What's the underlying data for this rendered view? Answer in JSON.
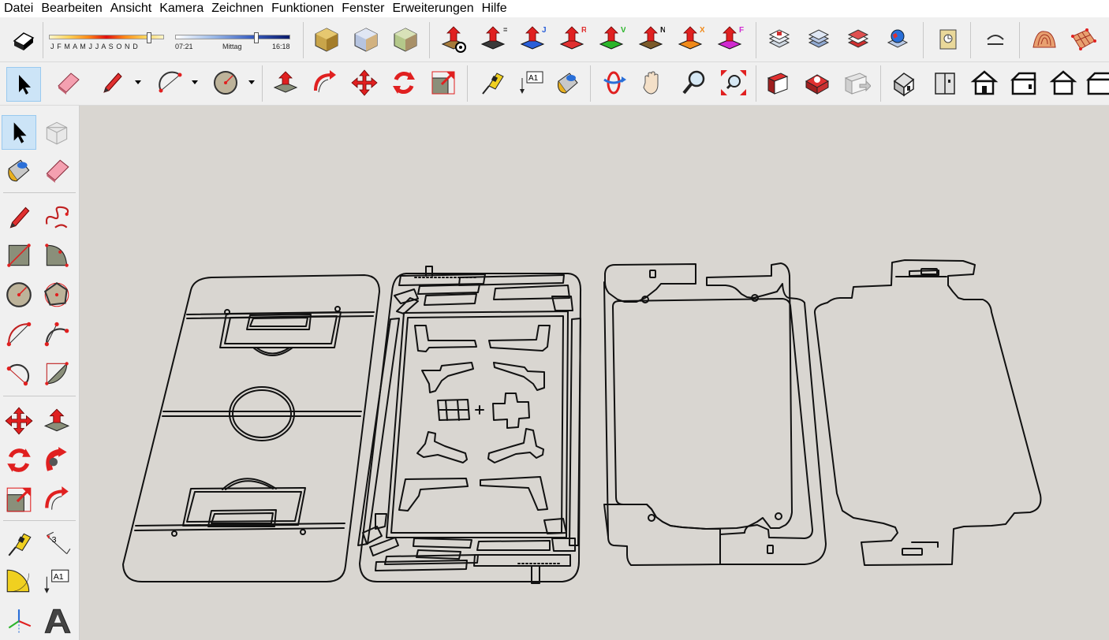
{
  "menubar": {
    "items": [
      "Datei",
      "Bearbeiten",
      "Ansicht",
      "Kamera",
      "Zeichnen",
      "Funktionen",
      "Fenster",
      "Erweiterungen",
      "Hilfe"
    ]
  },
  "shadow": {
    "months": "J F M A M J J A S O N D",
    "time_start": "07:21",
    "time_mid": "Mittag",
    "time_end": "16:18",
    "time_fraction": 0.86,
    "date_fraction": 0.88
  },
  "toolbar": {
    "text_tool_label": "A1",
    "push_pull_letters": [
      "=",
      "J",
      "R",
      "V",
      "N",
      "X",
      "F"
    ],
    "push_pull_colors": [
      "#3a3a3a",
      "#2a5fd8",
      "#e03030",
      "#2bb52b",
      "#7a5a2a",
      "#f08a1a",
      "#d02ad0"
    ]
  },
  "left_toolbar": {
    "dimension_label": "3",
    "text_tool_label": "A1"
  },
  "colors": {
    "viewport": "#d9d6d1",
    "active_tool": "#cce4f7",
    "accent_red": "#e02020",
    "outline": "#111111"
  }
}
